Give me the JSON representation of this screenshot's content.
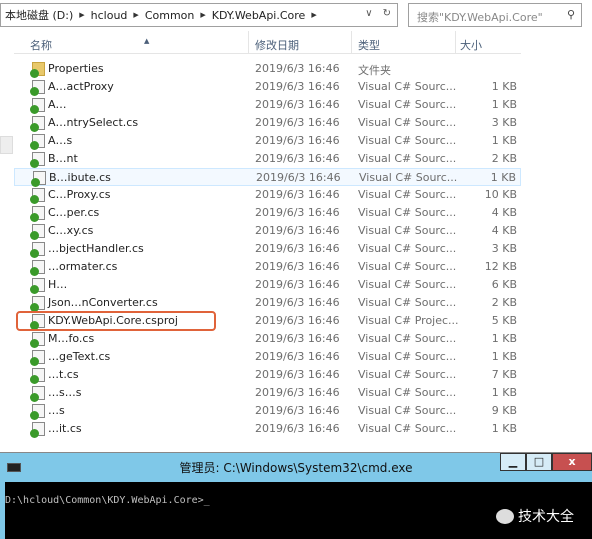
{
  "address": {
    "crumbs": [
      "本地磁盘 (D:)",
      "hcloud",
      "Common",
      "KDY.WebApi.Core"
    ]
  },
  "search": {
    "placeholder": "搜索\"KDY.WebApi.Core\""
  },
  "columns": {
    "name": "名称",
    "date": "修改日期",
    "type": "类型",
    "size": "大小"
  },
  "files": [
    {
      "name": "Properties",
      "date": "2019/6/3 16:46",
      "type": "文件夹",
      "size": "",
      "kind": "folder"
    },
    {
      "name": "A…actProxy",
      "date": "2019/6/3 16:46",
      "type": "Visual C# Sourc...",
      "size": "1 KB"
    },
    {
      "name": "A…",
      "date": "2019/6/3 16:46",
      "type": "Visual C# Sourc...",
      "size": "1 KB"
    },
    {
      "name": "A…ntrySelect.cs",
      "date": "2019/6/3 16:46",
      "type": "Visual C# Sourc...",
      "size": "3 KB"
    },
    {
      "name": "A…s",
      "date": "2019/6/3 16:46",
      "type": "Visual C# Sourc...",
      "size": "1 KB"
    },
    {
      "name": "B…nt",
      "date": "2019/6/3 16:46",
      "type": "Visual C# Sourc...",
      "size": "2 KB"
    },
    {
      "name": "B…ibute.cs",
      "date": "2019/6/3 16:46",
      "type": "Visual C# Sourc...",
      "size": "1 KB",
      "state": "hover"
    },
    {
      "name": "C…Proxy.cs",
      "date": "2019/6/3 16:46",
      "type": "Visual C# Sourc...",
      "size": "10 KB"
    },
    {
      "name": "C…per.cs",
      "date": "2019/6/3 16:46",
      "type": "Visual C# Sourc...",
      "size": "4 KB"
    },
    {
      "name": "C…xy.cs",
      "date": "2019/6/3 16:46",
      "type": "Visual C# Sourc...",
      "size": "4 KB"
    },
    {
      "name": "…bjectHandler.cs",
      "date": "2019/6/3 16:46",
      "type": "Visual C# Sourc...",
      "size": "3 KB"
    },
    {
      "name": "…ormater.cs",
      "date": "2019/6/3 16:46",
      "type": "Visual C# Sourc...",
      "size": "12 KB"
    },
    {
      "name": "H…",
      "date": "2019/6/3 16:46",
      "type": "Visual C# Sourc...",
      "size": "6 KB"
    },
    {
      "name": "Json…nConverter.cs",
      "date": "2019/6/3 16:46",
      "type": "Visual C# Sourc...",
      "size": "2 KB"
    },
    {
      "name": "KDY.WebApi.Core.csproj",
      "date": "2019/6/3 16:46",
      "type": "Visual C# Projec...",
      "size": "5 KB",
      "state": "highlighted"
    },
    {
      "name": "M…fo.cs",
      "date": "2019/6/3 16:46",
      "type": "Visual C# Sourc...",
      "size": "1 KB"
    },
    {
      "name": "…geText.cs",
      "date": "2019/6/3 16:46",
      "type": "Visual C# Sourc...",
      "size": "1 KB"
    },
    {
      "name": "…t.cs",
      "date": "2019/6/3 16:46",
      "type": "Visual C# Sourc...",
      "size": "7 KB"
    },
    {
      "name": "…s…s",
      "date": "2019/6/3 16:46",
      "type": "Visual C# Sourc...",
      "size": "1 KB"
    },
    {
      "name": "…s",
      "date": "2019/6/3 16:46",
      "type": "Visual C# Sourc...",
      "size": "9 KB"
    },
    {
      "name": "…it.cs",
      "date": "2019/6/3 16:46",
      "type": "Visual C# Sourc...",
      "size": "1 KB"
    }
  ],
  "cmd": {
    "title": "管理员: C:\\Windows\\System32\\cmd.exe",
    "prompt": "D:\\hcloud\\Common\\KDY.WebApi.Core>_",
    "minimize": "▁",
    "maximize": "□",
    "close": "x"
  },
  "watermark": "技术大全",
  "colors": {
    "highlight_border": "#e0633a",
    "cmd_titlebar": "#7fc8e8",
    "console_bg": "#000000"
  }
}
